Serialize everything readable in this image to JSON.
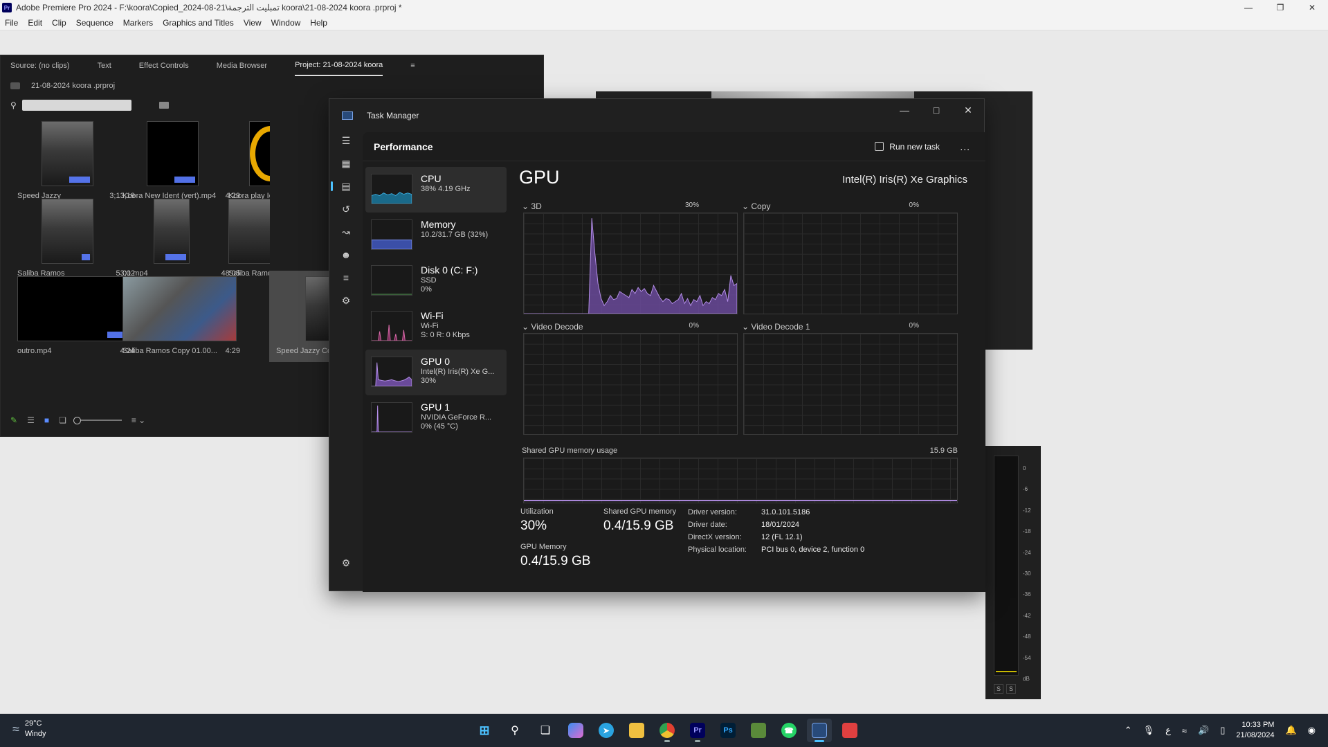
{
  "premiere": {
    "window_title": "Adobe Premiere Pro 2024 - F:\\koora\\Copied_2024-08-21\\تمبليت الترجمة koora\\21-08-2024 koora .prproj *",
    "logo_text": "Pr",
    "menu": [
      "File",
      "Edit",
      "Clip",
      "Sequence",
      "Markers",
      "Graphics and Titles",
      "View",
      "Window",
      "Help"
    ],
    "panel_tabs": [
      "Source: (no clips)",
      "Text",
      "Effect Controls",
      "Media Browser",
      "Project: 21-08-2024 koora"
    ],
    "project_file": "21-08-2024 koora .prproj",
    "clips": [
      {
        "name": "Speed Jazzy",
        "duration": "3;13;19"
      },
      {
        "name": "Koora New Ident (vert).mp4",
        "duration": "4:29"
      },
      {
        "name": "Koora play Ico",
        "duration": ""
      },
      {
        "name": "Saliba Ramos",
        "duration": "53;02"
      },
      {
        "name": "01.mp4",
        "duration": "48:05"
      },
      {
        "name": "Saliba Ramos C",
        "duration": ""
      },
      {
        "name": "outro.mp4",
        "duration": "4:24"
      },
      {
        "name": "Saliba Ramos Copy 01.00...",
        "duration": "4:29"
      },
      {
        "name": "Speed Jazzy Co",
        "duration": ""
      }
    ],
    "audio_scale": [
      "0",
      "-6",
      "-12",
      "-18",
      "-24",
      "-30",
      "-36",
      "-42",
      "-48",
      "-54",
      "dB"
    ],
    "audio_solo": [
      "S",
      "S"
    ]
  },
  "task_manager": {
    "title": "Task Manager",
    "page": "Performance",
    "run_new_task": "Run new task",
    "more": "...",
    "devices": [
      {
        "name": "CPU",
        "l2": "38% 4.19 GHz",
        "l3": ""
      },
      {
        "name": "Memory",
        "l2": "10.2/31.7 GB (32%)",
        "l3": ""
      },
      {
        "name": "Disk 0 (C: F:)",
        "l2": "SSD",
        "l3": "0%"
      },
      {
        "name": "Wi-Fi",
        "l2": "Wi-Fi",
        "l3": "S: 0 R: 0 Kbps"
      },
      {
        "name": "GPU 0",
        "l2": "Intel(R) Iris(R) Xe G...",
        "l3": "30%"
      },
      {
        "name": "GPU 1",
        "l2": "NVIDIA GeForce R...",
        "l3": "0% (45 °C)"
      }
    ],
    "gpu": {
      "heading": "GPU",
      "model": "Intel(R) Iris(R) Xe Graphics",
      "engines": [
        {
          "label": "3D",
          "pct": "30%"
        },
        {
          "label": "Copy",
          "pct": "0%"
        },
        {
          "label": "Video Decode",
          "pct": "0%"
        },
        {
          "label": "Video Decode 1",
          "pct": "0%"
        }
      ],
      "shared_label": "Shared GPU memory usage",
      "shared_max": "15.9 GB",
      "utilization_label": "Utilization",
      "utilization": "30%",
      "shared_mem_label": "Shared GPU memory",
      "shared_mem": "0.4/15.9 GB",
      "gpu_mem_label": "GPU Memory",
      "gpu_mem": "0.4/15.9 GB",
      "driver": [
        {
          "k": "Driver version:",
          "v": "31.0.101.5186"
        },
        {
          "k": "Driver date:",
          "v": "18/01/2024"
        },
        {
          "k": "DirectX version:",
          "v": "12 (FL 12.1)"
        },
        {
          "k": "Physical location:",
          "v": "PCI bus 0, device 2, function 0"
        }
      ],
      "graph_3d": [
        0,
        0,
        0,
        0,
        0,
        0,
        0,
        0,
        0,
        0,
        0,
        0,
        0,
        0,
        0,
        0,
        0,
        0,
        0,
        0,
        0,
        0,
        95,
        60,
        30,
        15,
        8,
        12,
        18,
        14,
        15,
        22,
        20,
        18,
        16,
        24,
        20,
        26,
        22,
        25,
        20,
        18,
        28,
        22,
        16,
        12,
        15,
        14,
        10,
        12,
        14,
        20,
        10,
        15,
        8,
        14,
        12,
        18,
        8,
        12,
        10,
        16,
        14,
        20,
        18,
        24,
        12,
        38,
        28,
        30
      ],
      "color": "#b48ee8"
    }
  },
  "taskbar": {
    "temperature": "29°C",
    "condition": "Windy",
    "time": "10:33 PM",
    "date": "21/08/2024",
    "lang": "ع"
  }
}
